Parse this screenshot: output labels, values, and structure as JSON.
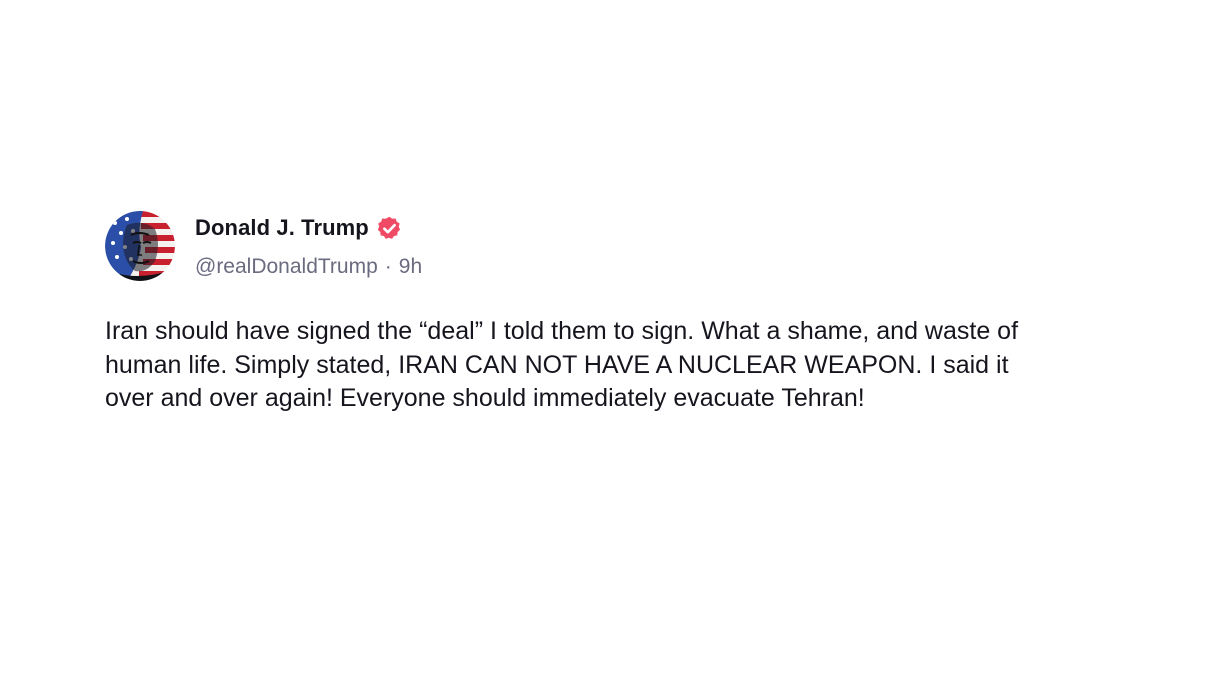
{
  "post": {
    "author": {
      "display_name": "Donald J. Trump",
      "handle": "@realDonaldTrump",
      "verified": true,
      "avatar_icon": "flag-portrait-avatar"
    },
    "time_separator": "·",
    "timestamp": "9h",
    "text": "Iran should have signed the “deal” I told them to sign. What a shame, and waste of human life. Simply stated, IRAN CAN NOT HAVE A NUCLEAR WEAPON. I said it over and over again! Everyone should immediately evacuate Tehran!"
  },
  "colors": {
    "verified_badge": "#f04b64",
    "meta_text": "#6b6b80",
    "body_text": "#15151e"
  }
}
